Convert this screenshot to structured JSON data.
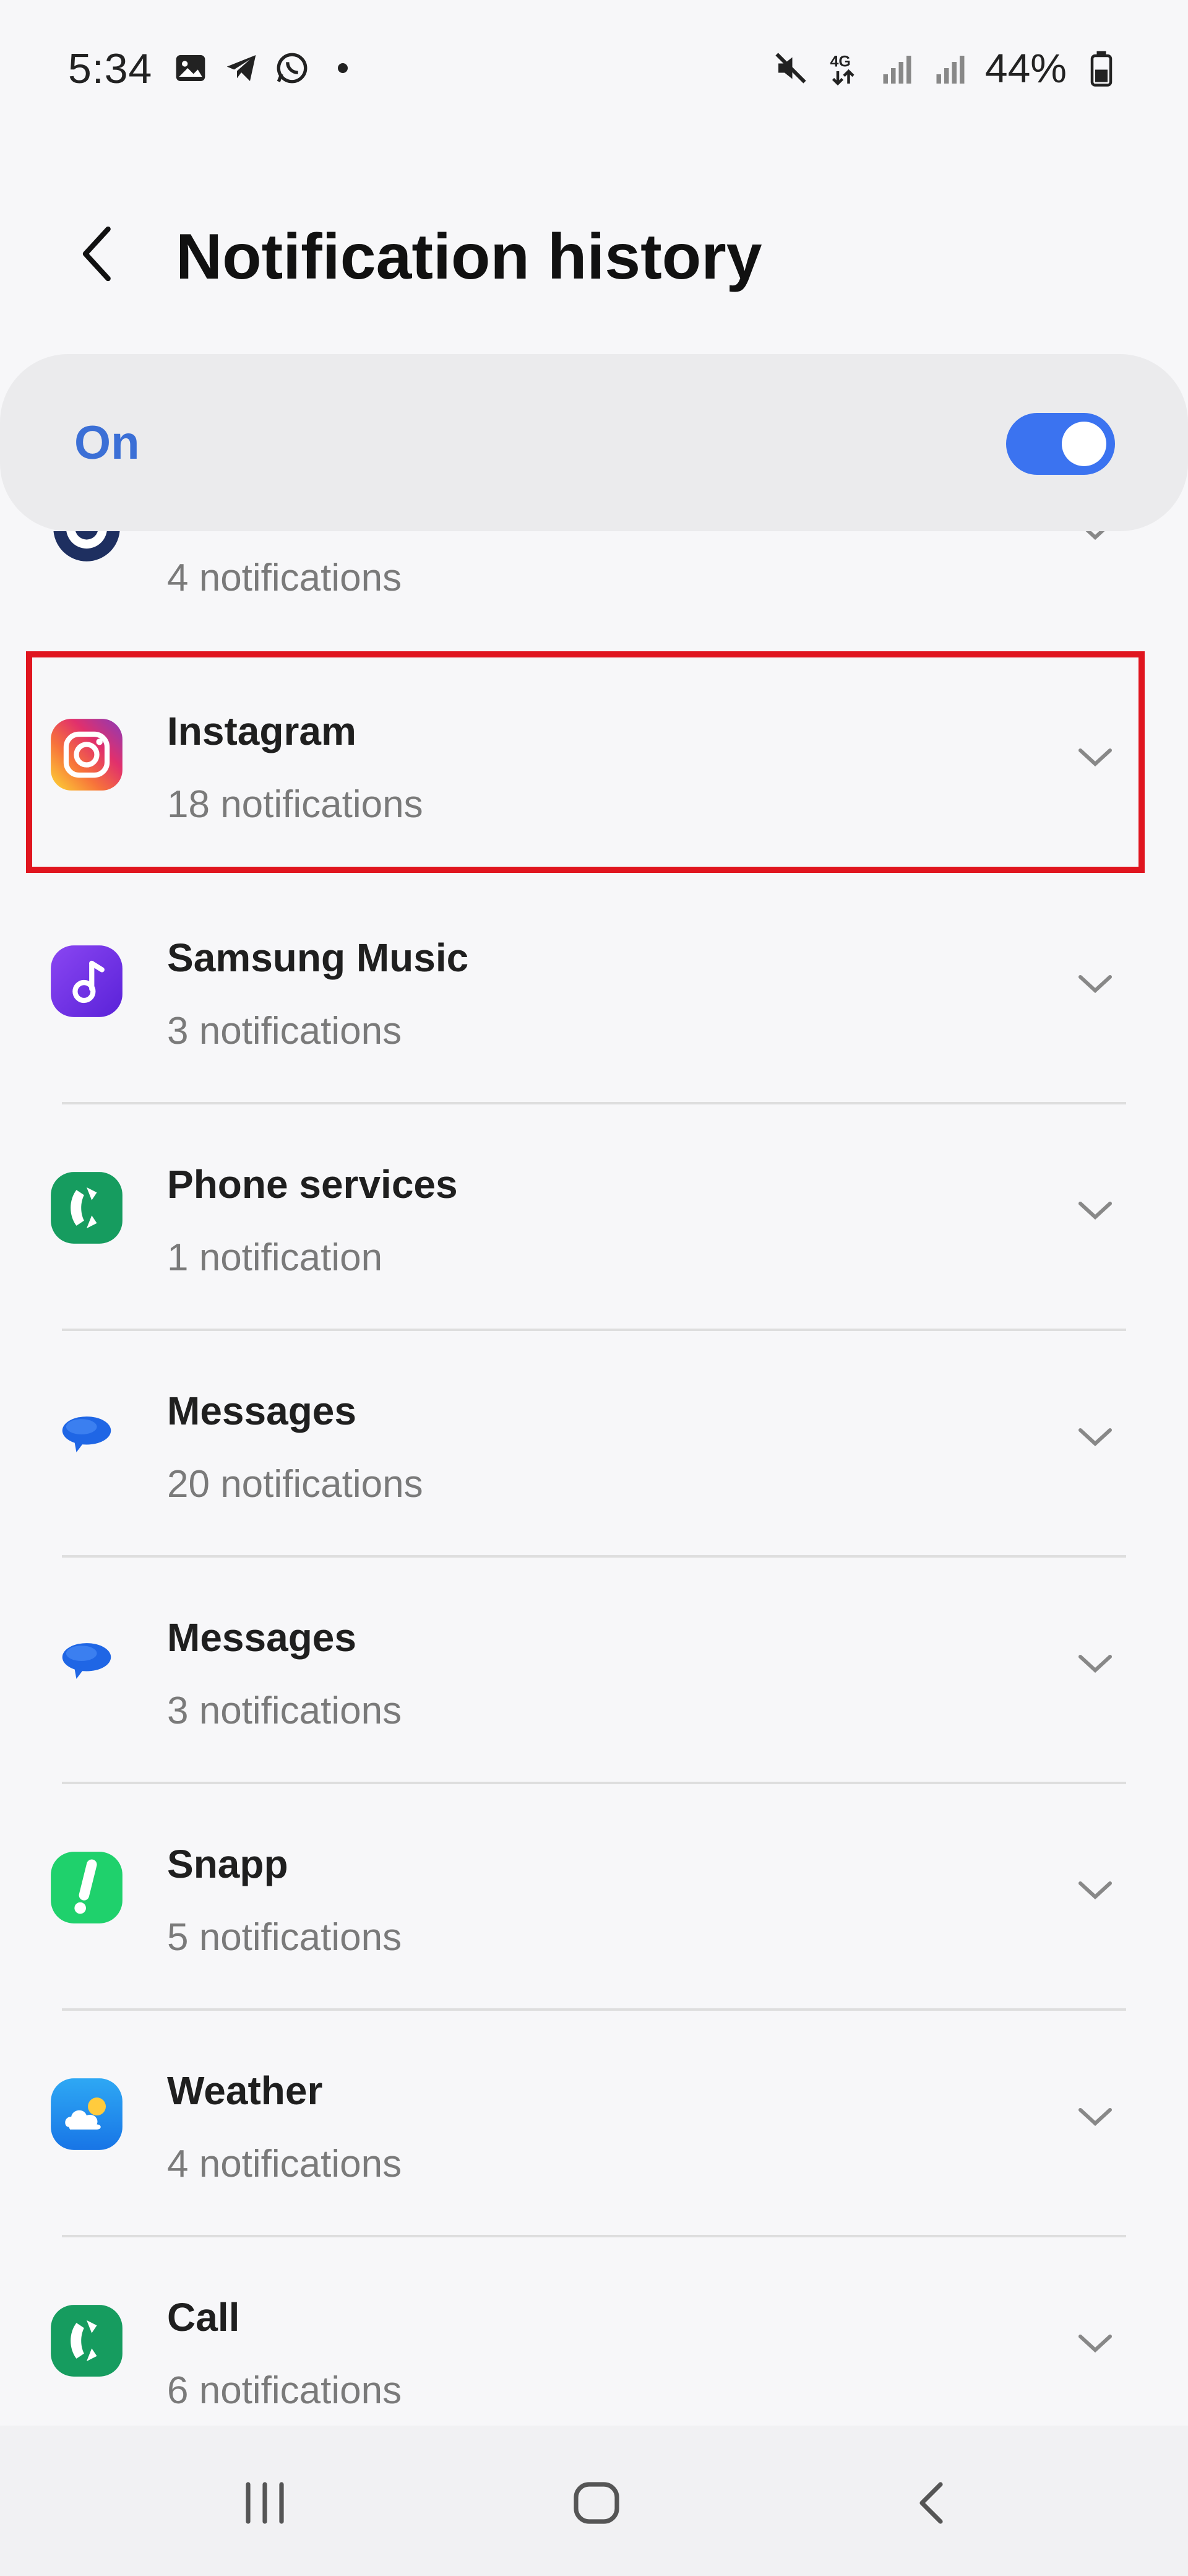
{
  "status_bar": {
    "time": "5:34",
    "battery": "44%",
    "icons": [
      "gallery-icon",
      "telegram-icon",
      "whatsapp-icon",
      "dot-icon",
      "mute-icon",
      "4g-icon",
      "signal-icon",
      "signal-icon",
      "battery-icon"
    ]
  },
  "header": {
    "title": "Notification history",
    "back_icon": "back-chevron-icon"
  },
  "master_switch": {
    "label": "On",
    "state": true,
    "accent": "#3b73f0"
  },
  "apps": [
    {
      "name": "",
      "count": "4 notifications",
      "icon": "partial-circle-app-icon"
    },
    {
      "name": "Instagram",
      "count": "18 notifications",
      "icon": "instagram-icon",
      "highlighted": true
    },
    {
      "name": "Samsung Music",
      "count": "3 notifications",
      "icon": "samsung-music-icon"
    },
    {
      "name": "Phone services",
      "count": "1 notification",
      "icon": "phone-services-icon"
    },
    {
      "name": "Messages",
      "count": "20 notifications",
      "icon": "messages-icon"
    },
    {
      "name": "Messages",
      "count": "3 notifications",
      "icon": "messages-icon"
    },
    {
      "name": "Snapp",
      "count": "5 notifications",
      "icon": "snapp-icon"
    },
    {
      "name": "Weather",
      "count": "4 notifications",
      "icon": "weather-icon"
    },
    {
      "name": "Call",
      "count": "6 notifications",
      "icon": "call-icon"
    }
  ],
  "nav_bar": {
    "buttons": [
      "recents-icon",
      "home-icon",
      "back-icon"
    ]
  },
  "colors": {
    "highlight": "#e0151f",
    "toggle_on": "#3b73f0",
    "title_text": "#111111",
    "subtitle_text": "#7a7a7a"
  }
}
